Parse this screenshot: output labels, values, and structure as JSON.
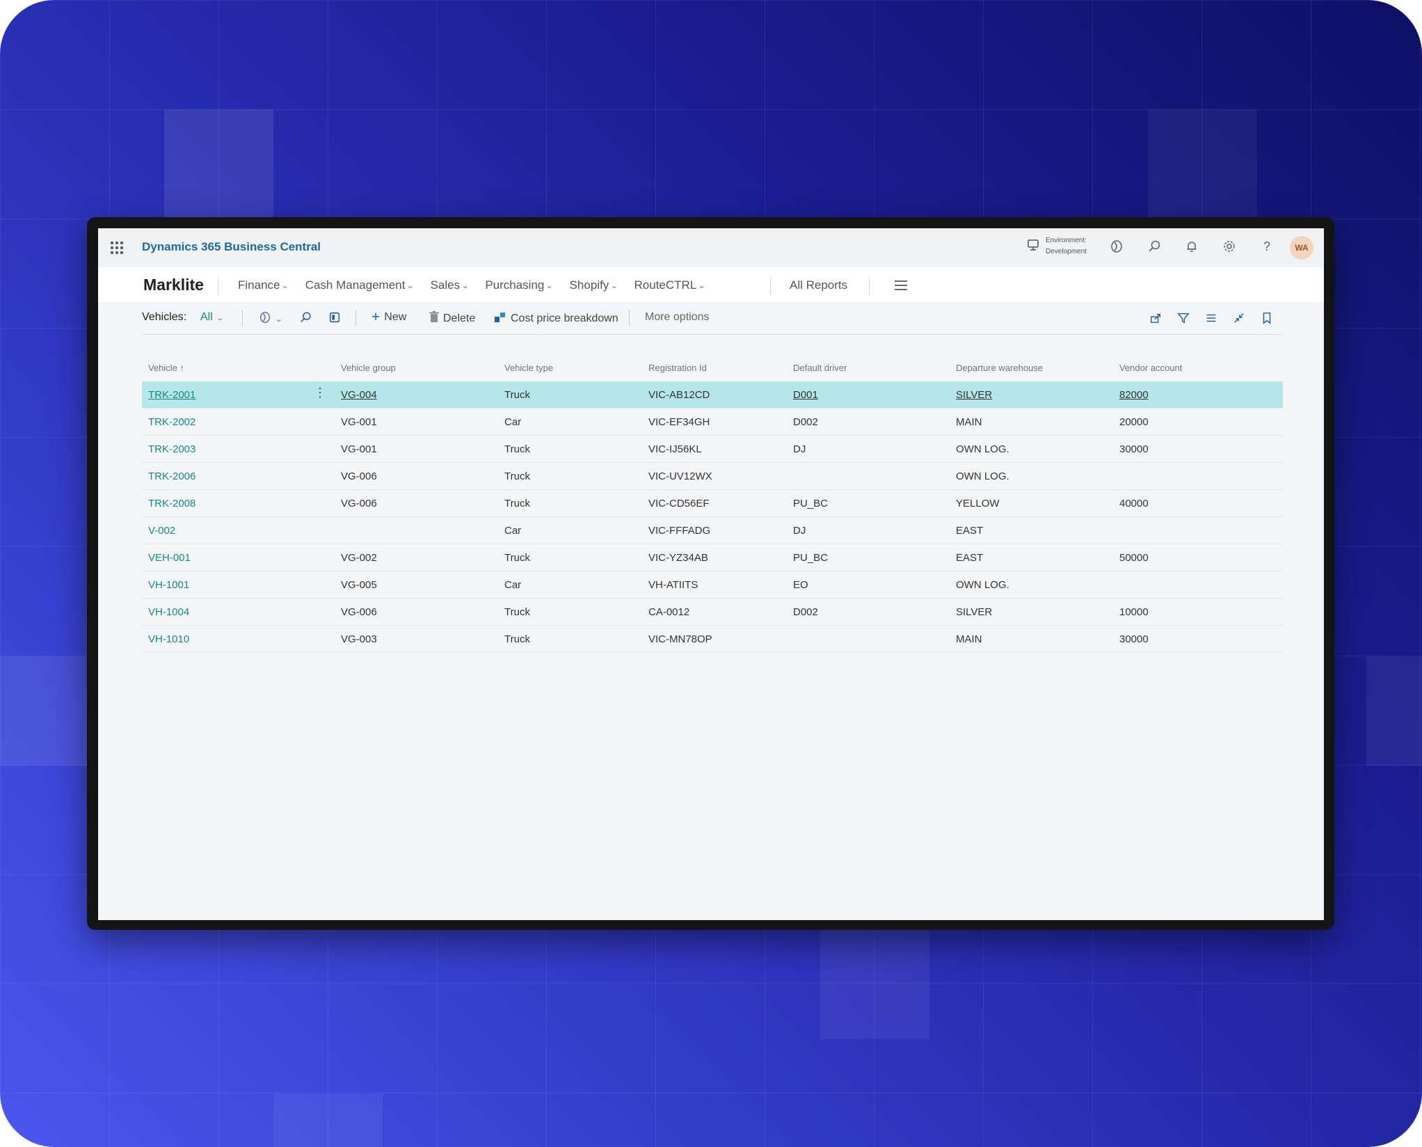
{
  "topbar": {
    "product_name": "Dynamics 365 Business Central",
    "environment_label": "Environment:",
    "environment_value": "Development",
    "avatar_initials": "WA",
    "icons": [
      "waffle-menu-icon",
      "environment-icon",
      "copilot-icon",
      "search-icon",
      "bell-icon",
      "gear-icon",
      "help-icon"
    ]
  },
  "nav": {
    "company": "Marklite",
    "menus": [
      "Finance",
      "Cash Management",
      "Sales",
      "Purchasing",
      "Shopify",
      "RouteCTRL"
    ],
    "all_reports": "All Reports"
  },
  "actions": {
    "page_caption": "Vehicles:",
    "view_filter": "All",
    "new_label": "New",
    "delete_label": "Delete",
    "cost_label": "Cost price breakdown",
    "more_label": "More options",
    "right_icons": [
      "share-icon",
      "filter-icon",
      "list-view-icon",
      "collapse-icon",
      "bookmark-icon"
    ]
  },
  "table": {
    "columns": [
      "Vehicle ↑",
      "Vehicle group",
      "Vehicle type",
      "Registration Id",
      "Default driver",
      "Departure warehouse",
      "Vendor account"
    ],
    "rows": [
      {
        "vehicle": "TRK-2001",
        "group": "VG-004",
        "type": "Truck",
        "reg": "VIC-AB12CD",
        "driver": "D001",
        "warehouse": "SILVER",
        "vendor": "82000",
        "selected": true
      },
      {
        "vehicle": "TRK-2002",
        "group": "VG-001",
        "type": "Car",
        "reg": "VIC-EF34GH",
        "driver": "D002",
        "warehouse": "MAIN",
        "vendor": "20000"
      },
      {
        "vehicle": "TRK-2003",
        "group": "VG-001",
        "type": "Truck",
        "reg": "VIC-IJ56KL",
        "driver": "DJ",
        "warehouse": "OWN LOG.",
        "vendor": "30000"
      },
      {
        "vehicle": "TRK-2006",
        "group": "VG-006",
        "type": "Truck",
        "reg": "VIC-UV12WX",
        "driver": "",
        "warehouse": "OWN LOG.",
        "vendor": ""
      },
      {
        "vehicle": "TRK-2008",
        "group": "VG-006",
        "type": "Truck",
        "reg": "VIC-CD56EF",
        "driver": "PU_BC",
        "warehouse": "YELLOW",
        "vendor": "40000"
      },
      {
        "vehicle": "V-002",
        "group": "",
        "type": "Car",
        "reg": "VIC-FFFADG",
        "driver": "DJ",
        "warehouse": "EAST",
        "vendor": ""
      },
      {
        "vehicle": "VEH-001",
        "group": "VG-002",
        "type": "Truck",
        "reg": "VIC-YZ34AB",
        "driver": "PU_BC",
        "warehouse": "EAST",
        "vendor": "50000"
      },
      {
        "vehicle": "VH-1001",
        "group": "VG-005",
        "type": "Car",
        "reg": "VH-ATIITS",
        "driver": "EO",
        "warehouse": "OWN LOG.",
        "vendor": ""
      },
      {
        "vehicle": "VH-1004",
        "group": "VG-006",
        "type": "Truck",
        "reg": "CA-0012",
        "driver": "D002",
        "warehouse": "SILVER",
        "vendor": "10000"
      },
      {
        "vehicle": "VH-1010",
        "group": "VG-003",
        "type": "Truck",
        "reg": "VIC-MN78OP",
        "driver": "",
        "warehouse": "MAIN",
        "vendor": "30000"
      }
    ]
  },
  "colors": {
    "accent": "#138a8a",
    "brand": "#1a6aa8",
    "selected_row": "#b4e6ea"
  }
}
